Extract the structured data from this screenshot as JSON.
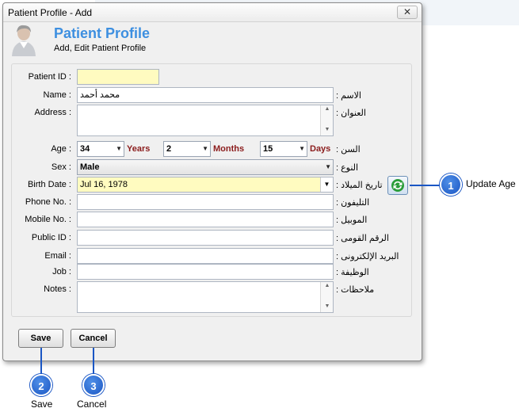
{
  "window": {
    "title": "Patient Profile - Add",
    "close_label": "✕"
  },
  "header": {
    "title": "Patient Profile",
    "subtitle": "Add, Edit Patient Profile"
  },
  "fields": {
    "patient_id": {
      "label": "Patient ID :",
      "value": ""
    },
    "name": {
      "label": "Name :",
      "label_ar": "الاسم :",
      "value": "محمد أحمد"
    },
    "address": {
      "label": "Address :",
      "label_ar": "العنوان :",
      "value": ""
    },
    "age": {
      "label": "Age :",
      "label_ar": "السن :",
      "years": "34",
      "years_unit": "Years",
      "months": "2",
      "months_unit": "Months",
      "days": "15",
      "days_unit": "Days"
    },
    "sex": {
      "label": "Sex :",
      "label_ar": "النوع :",
      "value": "Male"
    },
    "birth_date": {
      "label": "Birth Date :",
      "label_ar": "تاريخ الميلاد :",
      "value": "Jul 16, 1978"
    },
    "phone": {
      "label": "Phone No. :",
      "label_ar": "التليفون :",
      "value": ""
    },
    "mobile": {
      "label": "Mobile No. :",
      "label_ar": "الموبيل :",
      "value": ""
    },
    "public_id": {
      "label": "Public ID :",
      "label_ar": "الرقم القومى :",
      "value": ""
    },
    "email": {
      "label": "Email :",
      "label_ar": "البريد الإلكترونى :",
      "value": ""
    },
    "job": {
      "label": "Job :",
      "label_ar": "الوظيفة :",
      "value": ""
    },
    "notes": {
      "label": "Notes :",
      "label_ar": "ملاحظات :",
      "value": ""
    }
  },
  "buttons": {
    "save": "Save",
    "cancel": "Cancel"
  },
  "callouts": [
    {
      "number": "1",
      "text": "Update Age"
    },
    {
      "number": "2",
      "text": "Save"
    },
    {
      "number": "3",
      "text": "Cancel"
    }
  ],
  "colors": {
    "accent_title": "#3d8fe0",
    "unit_text": "#8b1c1c",
    "highlight_field": "#fffbc0",
    "callout": "#1a56c4"
  }
}
